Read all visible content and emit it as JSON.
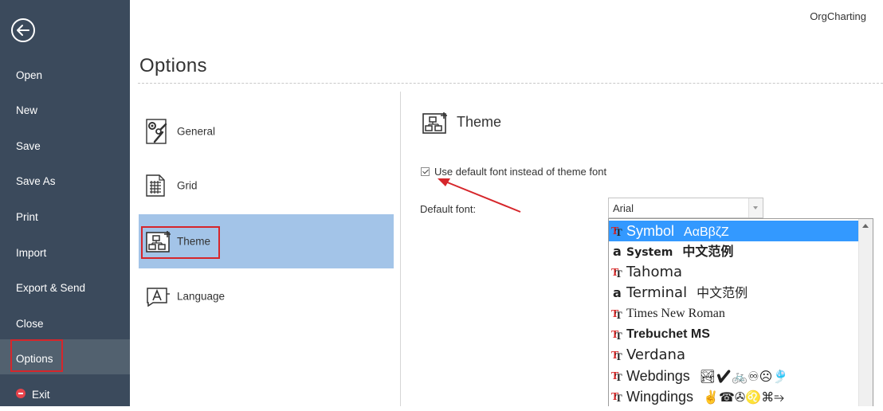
{
  "app": {
    "name": "OrgCharting"
  },
  "sidebar": {
    "items": [
      {
        "label": "Open"
      },
      {
        "label": "New"
      },
      {
        "label": "Save"
      },
      {
        "label": "Save As"
      },
      {
        "label": "Print"
      },
      {
        "label": "Import"
      },
      {
        "label": "Export & Send"
      },
      {
        "label": "Close"
      },
      {
        "label": "Options"
      },
      {
        "label": "Exit"
      }
    ],
    "active": "Options"
  },
  "page": {
    "title": "Options"
  },
  "categories": [
    {
      "label": "General",
      "icon": "general-settings-icon"
    },
    {
      "label": "Grid",
      "icon": "grid-icon"
    },
    {
      "label": "Theme",
      "icon": "theme-icon",
      "selected": true
    },
    {
      "label": "Language",
      "icon": "language-icon"
    }
  ],
  "panel": {
    "title": "Theme",
    "checkbox_label": "Use default font instead of theme font",
    "checkbox_checked": true,
    "default_font_label": "Default font:",
    "default_font_value": "Arial"
  },
  "font_list": [
    {
      "name": "Symbol",
      "sample": "ΑαΒβζΖ",
      "type": "truetype",
      "highlighted": true
    },
    {
      "name": "System",
      "sample": "中文范例",
      "type": "bitmap"
    },
    {
      "name": "Tahoma",
      "sample": "",
      "type": "truetype"
    },
    {
      "name": "Terminal",
      "sample": "中文范例",
      "type": "bitmap"
    },
    {
      "name": "Times New Roman",
      "sample": "",
      "type": "truetype"
    },
    {
      "name": "Trebuchet MS",
      "sample": "",
      "type": "truetype"
    },
    {
      "name": "Verdana",
      "sample": "",
      "type": "truetype"
    },
    {
      "name": "Webdings",
      "sample": "🏞✔🚲♾☹🎐",
      "type": "truetype"
    },
    {
      "name": "Wingdings",
      "sample": "✌☎✇♌⌘⥱",
      "type": "truetype"
    }
  ],
  "colors": {
    "sidebar_bg": "#3b4a5c",
    "sidebar_active": "#52616f",
    "selection_bg": "#a3c4e8",
    "list_highlight": "#3399ff",
    "annotation_red": "#d6262b"
  }
}
